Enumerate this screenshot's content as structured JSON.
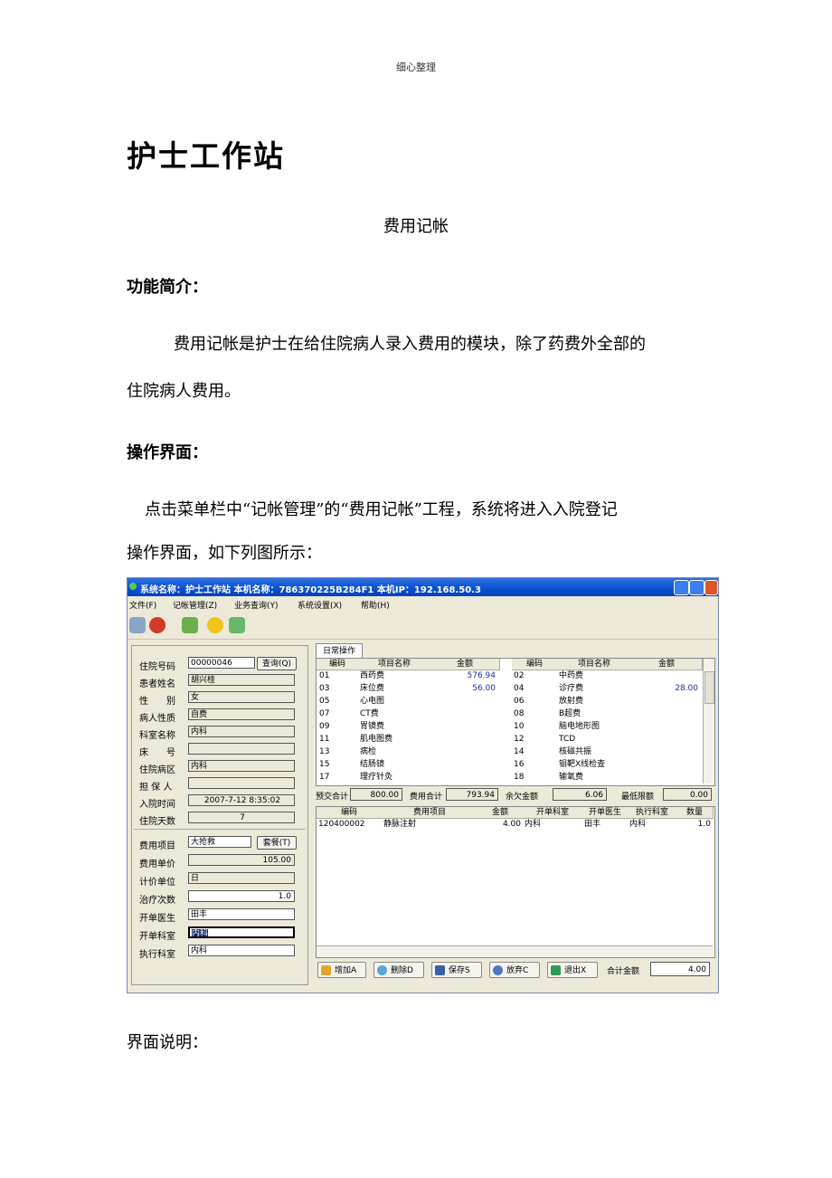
{
  "header_note": "细心整理",
  "doc_title": "护士工作站",
  "sub_title": "费用记帐",
  "section_intro": "功能简介：",
  "intro_line1": "费用记帐是护士在给住院病人录入费用的模块，除了药费外全部的",
  "intro_line2": "住院病人费用。",
  "section_ui": "操作界面：",
  "ui_line1": "点击菜单栏中“记帐管理”的“费用记帐”工程，系统将进入入院登记",
  "ui_line2": "操作界面，如下列图所示：",
  "section_desc": "界面说明：",
  "window": {
    "title": "系统名称：护士工作站    本机名称：786370225B284F1    本机IP：192.168.50.3",
    "menu": [
      "文件(F)",
      "记帐管理(Z)",
      "业务查询(Y)",
      "系统设置(X)",
      "帮助(H)"
    ],
    "left": {
      "labels": [
        "住院号码",
        "患者姓名",
        "性　　别",
        "病人性质",
        "科室名称",
        "床　　号",
        "住院病区",
        "担 保 人",
        "入院时间",
        "住院天数"
      ],
      "values": [
        "00000046",
        "胡兴桂",
        "女",
        "自费",
        "内科",
        "",
        "内科",
        "",
        "2007-7-12 8:35:02",
        "7"
      ],
      "query_button": "查询(Q)",
      "fee_labels": [
        "费用项目",
        "费用单价",
        "计价单位",
        "治疗次数",
        "开单医生",
        "开单科室",
        "执行科室"
      ],
      "fee_values": [
        "大抢救",
        "105.00",
        "日",
        "1.0",
        "田丰",
        "内科",
        "内科"
      ],
      "set_button": "套餐(T)"
    },
    "tab": "日常操作",
    "grid1": {
      "headers": [
        "编码",
        "项目名称",
        "金额",
        "编码",
        "项目名称",
        "金额"
      ],
      "rows": [
        [
          "01",
          "西药费",
          "576.94",
          "02",
          "中药费",
          ""
        ],
        [
          "03",
          "床位费",
          "56.00",
          "04",
          "诊疗费",
          "28.00"
        ],
        [
          "05",
          "心电图",
          "",
          "06",
          "放射费",
          ""
        ],
        [
          "07",
          "CT费",
          "",
          "08",
          "B超费",
          ""
        ],
        [
          "09",
          "胃镜费",
          "",
          "10",
          "脑电地形图",
          ""
        ],
        [
          "11",
          "肌电图费",
          "",
          "12",
          "TCD",
          ""
        ],
        [
          "13",
          "病检",
          "",
          "14",
          "核磁共振",
          ""
        ],
        [
          "15",
          "结肠镜",
          "",
          "16",
          "钼靶X线检查",
          ""
        ],
        [
          "17",
          "理疗针灸",
          "",
          "18",
          "输氧费",
          ""
        ]
      ]
    },
    "summary": {
      "prepay_label": "预交合计",
      "prepay": "800.00",
      "fee_label": "费用合计",
      "fee": "793.94",
      "balance_label": "余欠金额",
      "balance": "6.06",
      "limit_label": "最低限额",
      "limit": "0.00"
    },
    "grid2": {
      "headers": [
        "编码",
        "费用项目",
        "金额",
        "开单科室",
        "开单医生",
        "执行科室",
        "数量"
      ],
      "rows": [
        [
          "120400002",
          "静脉注射",
          "4.00",
          "内科",
          "田丰",
          "内科",
          "1.0"
        ]
      ]
    },
    "buttons": [
      "增加A",
      "删除D",
      "保存S",
      "放弃C",
      "退出X"
    ],
    "total_label": "合计金额",
    "total": "4.00",
    "colors": {
      "titlebar": "#0a4fd0",
      "panel": "#ece9d8",
      "amount_blue": "#1a2fa0"
    }
  }
}
